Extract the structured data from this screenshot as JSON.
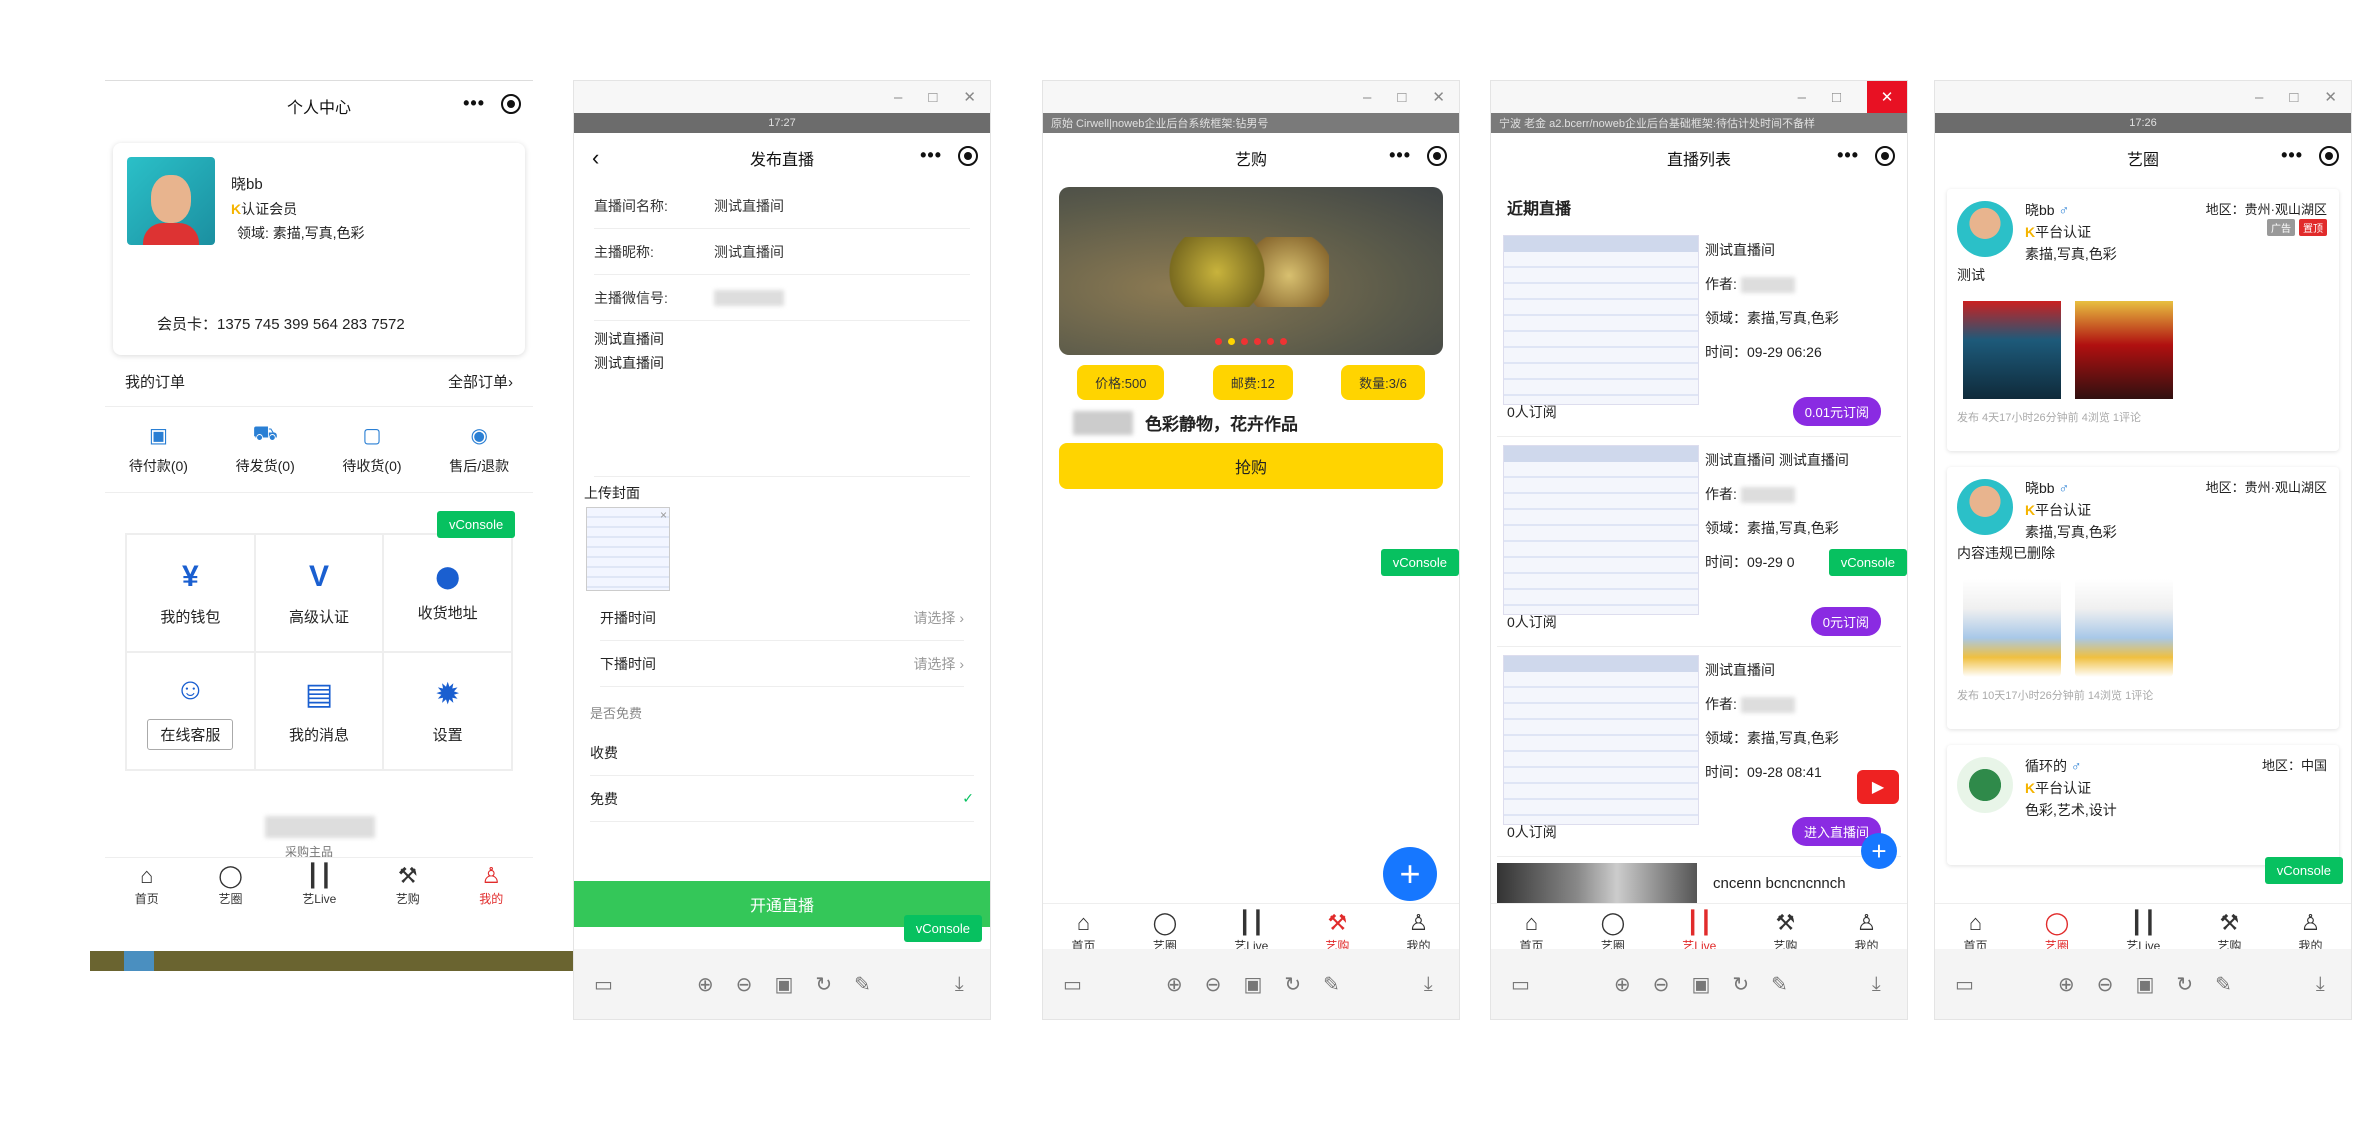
{
  "common": {
    "win_min": "–",
    "win_max": "□",
    "win_close": "✕",
    "vconsole": "vConsole",
    "more_dots": "•••"
  },
  "tabs": [
    {
      "label": "首页",
      "icon": "home-icon"
    },
    {
      "label": "艺圈",
      "icon": "chat-bubble-icon"
    },
    {
      "label": "艺Live",
      "icon": "live-bars-icon"
    },
    {
      "label": "艺购",
      "icon": "auction-hammer-icon"
    },
    {
      "label": "我的",
      "icon": "user-icon"
    }
  ],
  "panel1": {
    "title": "个人中心",
    "profile": {
      "name": "晓bb",
      "badge_mark": "K",
      "badge": "认证会员",
      "domain": "领域: 素描,写真,色彩",
      "card": "会员卡：1375 745 399 564 283 7572"
    },
    "orders_title": "我的订单",
    "orders_all": "全部订单›",
    "orders": [
      {
        "label": "待付款(0)",
        "icon": "wallet-card-icon"
      },
      {
        "label": "待发货(0)",
        "icon": "truck-icon"
      },
      {
        "label": "待收货(0)",
        "icon": "package-icon"
      },
      {
        "label": "售后/退款",
        "icon": "refund-icon"
      }
    ],
    "grid": [
      {
        "label": "我的钱包",
        "icon": "yen-icon",
        "glyph": "¥"
      },
      {
        "label": "高级认证",
        "icon": "vimeo-v-icon",
        "glyph": "V"
      },
      {
        "label": "收货地址",
        "icon": "location-pin-icon",
        "glyph": "⬤"
      },
      {
        "label": "在线客服",
        "icon": "service-people-icon",
        "glyph": "☺"
      },
      {
        "label": "我的消息",
        "icon": "message-icon",
        "glyph": "▤"
      },
      {
        "label": "设置",
        "icon": "settings-gear-icon",
        "glyph": "✹"
      }
    ],
    "footer_caption": "采购主品"
  },
  "panel2": {
    "status_time": "17:27",
    "title": "发布直播",
    "fields": [
      {
        "label": "直播间名称:",
        "value": "测试直播间"
      },
      {
        "label": "主播昵称:",
        "value": "测试直播间"
      },
      {
        "label": "主播微信号:",
        "value": ""
      }
    ],
    "desc_lines": [
      "测试直播间",
      "测试直播间"
    ],
    "upload_label": "上传封面",
    "start_label": "开播时间",
    "end_label": "下播时间",
    "picker_placeholder": "请选择 ›",
    "section_label": "是否免费",
    "options": [
      {
        "label": "收费",
        "checked": ""
      },
      {
        "label": "免费",
        "checked": "✓"
      }
    ],
    "submit": "开通直播"
  },
  "panel3": {
    "status_text": "原始 Cirwell|noweb企业后台系统框架:钻男号",
    "title": "艺购",
    "pills": [
      "价格:500",
      "邮费:12",
      "数量:3/6"
    ],
    "art_title": "色彩静物，花卉作品",
    "buy": "抢购"
  },
  "panel4": {
    "status_text": "宁波 老金 a2.bcerr/noweb企业后台基础框架:待估计处时间不备样",
    "side_char": "关",
    "title": "直播列表",
    "section": "近期直播",
    "lives": [
      {
        "name": "测试直播间",
        "author": "作者:",
        "domain": "领域：素描,写真,色彩",
        "time": "时间：09-29 06:26",
        "subs": "0人订阅",
        "btn": "0.01元订阅"
      },
      {
        "name": "测试直播间 测试直播间",
        "author": "作者:",
        "domain": "领域：素描,写真,色彩",
        "time": "时间：09-29 0",
        "subs": "0人订阅",
        "btn": "0元订阅"
      },
      {
        "name": "测试直播间",
        "author": "作者:",
        "domain": "领域：素描,写真,色彩",
        "time": "时间：09-28 08:41",
        "subs": "0人订阅",
        "btn": "进入直播间"
      }
    ],
    "next_title": "cncenn bcncncnnch"
  },
  "panel5": {
    "status_time": "17:26",
    "title": "艺圈",
    "posts": [
      {
        "name": "晓bb",
        "sex": "♂",
        "verified": "平台认证",
        "domain": "素描,写真,色彩",
        "region": "地区：贵州·观山湖区",
        "text": "测试",
        "meta": "发布 4天17小时26分钟前 4浏览 1评论",
        "tag1": "广告",
        "tag2": "置顶"
      },
      {
        "name": "晓bb",
        "sex": "♂",
        "verified": "平台认证",
        "domain": "素描,写真,色彩",
        "region": "地区：贵州·观山湖区",
        "text": "内容违规已删除",
        "meta": "发布 10天17小时26分钟前 14浏览 1评论",
        "tag1": "",
        "tag2": ""
      },
      {
        "name": "循环的",
        "sex": "♂",
        "verified": "平台认证",
        "domain": "色彩,艺术,设计",
        "region": "地区：中国",
        "text": "",
        "meta": "",
        "tag1": "",
        "tag2": ""
      }
    ]
  },
  "colors": {
    "accent_red": "#e12b2b",
    "vconsole_green": "#07c160",
    "yellow": "#ffd400",
    "purple": "#8a2be2",
    "fab_blue": "#1677ff"
  }
}
